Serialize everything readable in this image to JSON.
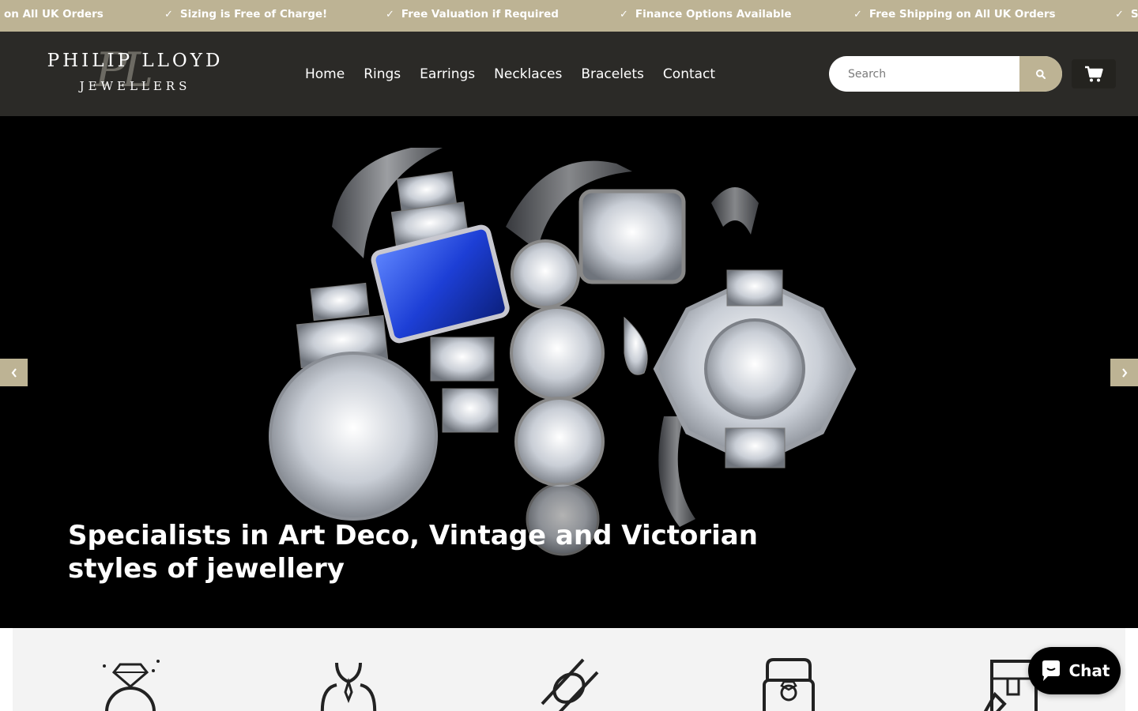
{
  "colors": {
    "accent": "#bdb394",
    "header_bg": "#2b2a27",
    "hero_bg": "#000000",
    "features_bg": "#f3f3f3"
  },
  "announcement": {
    "items": [
      "on All UK Orders",
      "Sizing is Free of Charge!",
      "Free Valuation if Required",
      "Finance Options Available",
      "Free Shipping on All UK Orders",
      "S"
    ],
    "check_symbol": "✓"
  },
  "logo": {
    "line1": "PHILIP LLOYD",
    "line2": "JEWELLERS",
    "monogram": "PL"
  },
  "nav": {
    "items": [
      "Home",
      "Rings",
      "Earrings",
      "Necklaces",
      "Bracelets",
      "Contact"
    ]
  },
  "search": {
    "placeholder": "Search",
    "icon": "search-icon"
  },
  "cart": {
    "icon": "cart-icon"
  },
  "hero": {
    "caption": "Specialists in Art Deco, Vintage and Victorian styles of jewellery",
    "prev_icon": "chevron-left-icon",
    "next_icon": "chevron-right-icon"
  },
  "features": {
    "icons": [
      "diamond-ring-icon",
      "necklace-bust-icon",
      "gemstone-tweezers-icon",
      "ring-box-icon",
      "shipping-box-icon"
    ]
  },
  "chat": {
    "label": "Chat",
    "icon": "chat-bubble-icon"
  }
}
